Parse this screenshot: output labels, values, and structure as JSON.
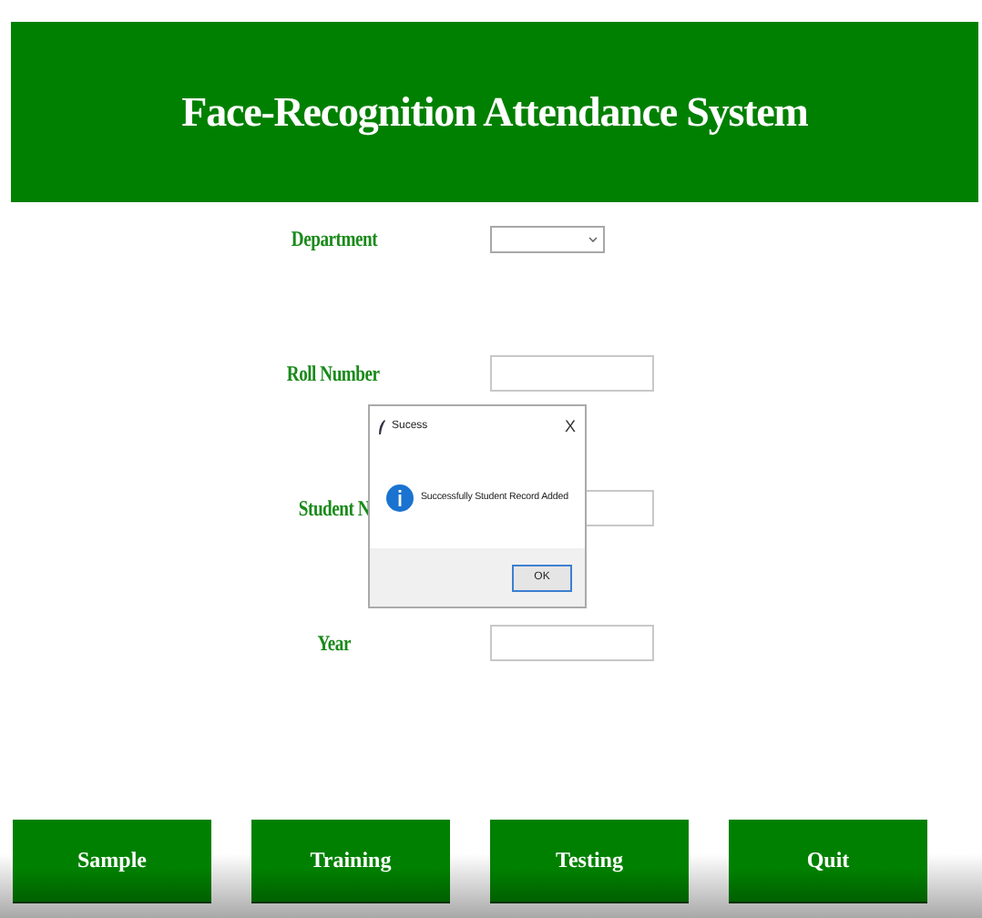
{
  "header": {
    "title": "Face-Recognition Attendance System"
  },
  "fields": [
    {
      "label": "Department",
      "kind": "dropdown"
    },
    {
      "label": "Roll Number",
      "kind": "text"
    },
    {
      "label": "Student N",
      "kind": "text"
    },
    {
      "label": "Year",
      "kind": "text"
    }
  ],
  "dialog": {
    "title": "Sucess",
    "close": "X",
    "message": "Successfully Student Record Added",
    "button": "OK"
  },
  "buttons": [
    "Sample",
    "Training",
    "Testing",
    "Quit"
  ]
}
